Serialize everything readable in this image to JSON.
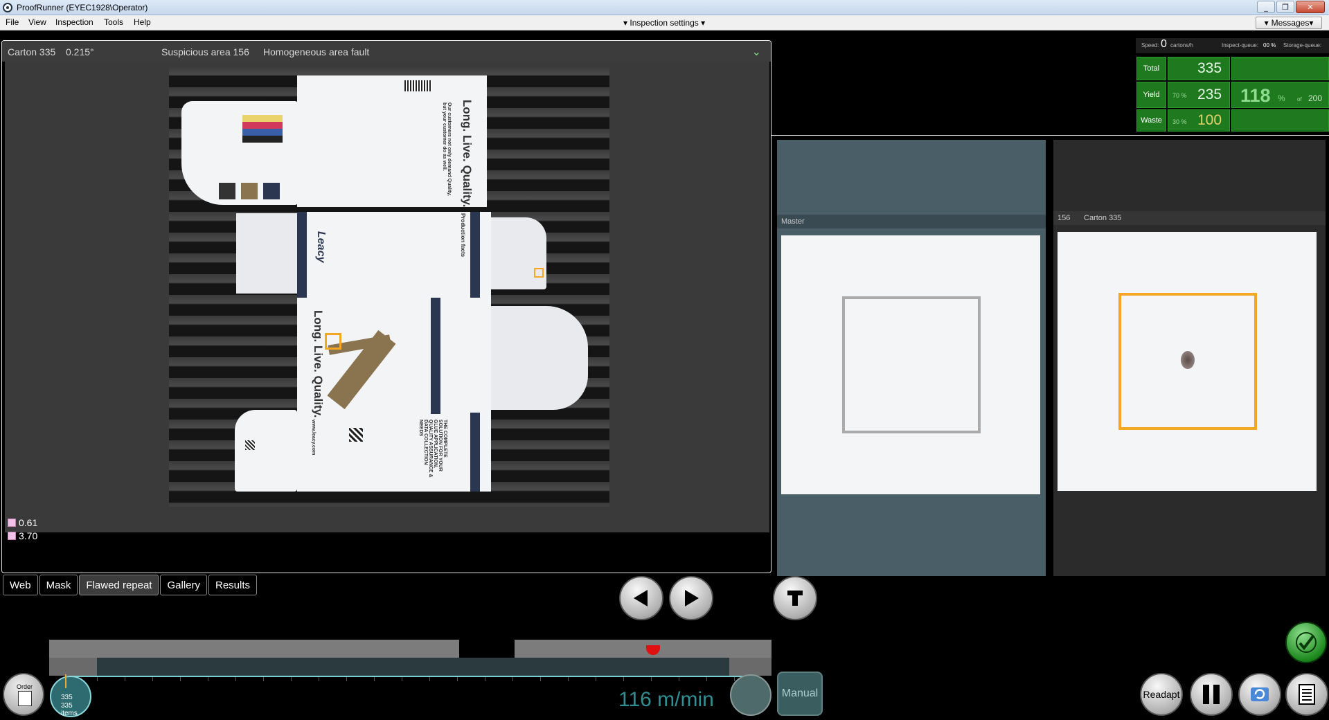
{
  "window": {
    "title": "ProofRunner  (EYEC1928\\Operator)"
  },
  "menu": {
    "items": [
      "File",
      "View",
      "Inspection",
      "Tools",
      "Help"
    ],
    "inspection_settings": "Inspection settings",
    "messages": "Messages"
  },
  "inspection": {
    "carton": "Carton  335",
    "angle": "0.215°",
    "area": "Suspicious area 156",
    "fault": "Homogeneous area fault"
  },
  "measurements": [
    "0.61",
    "3.70"
  ],
  "carton_print": {
    "slogan": "Long. Live. Quality.",
    "demand": "Our customers not only demand Quality, but your customer do as well.",
    "production": "Production facts",
    "brand": "Leacy",
    "www": "www.leacy.com",
    "solution": "THE COMPLETE SOLUTION FOR YOUR GLUE APPLICATION, QUALITY ASSURANCE & DATA COLLECTION NEEDS"
  },
  "tabs": [
    "Web",
    "Mask",
    "Flawed repeat",
    "Gallery",
    "Results"
  ],
  "stats": {
    "speed_label": "Speed:",
    "speed_value": "0",
    "speed_unit": "cartons/h",
    "inspect_queue_label": "Inspect-queue:",
    "inspect_queue_value": "00 %",
    "storage_queue_label": "Storage-queue:",
    "total_label": "Total",
    "total_value": "335",
    "yield_label": "Yield",
    "yield_pct": "70 %",
    "yield_value": "235",
    "big_pct": "118",
    "big_pct_sign": "%",
    "of_label": "of",
    "of_value": "200",
    "waste_label": "Waste",
    "waste_pct": "30 %",
    "waste_value": "100"
  },
  "compare": {
    "master": "Master",
    "area_id": "156",
    "carton": "Carton 335"
  },
  "timeline": {
    "position": "335",
    "items": "335 items",
    "speed": "116 m/min",
    "manual": "Manual",
    "order": "Order"
  },
  "actions": {
    "readapt": "Readapt"
  },
  "colors": {
    "accent": "#f5a623",
    "stat_green": "#1f7a1f",
    "timeline": "#7acfd3"
  }
}
